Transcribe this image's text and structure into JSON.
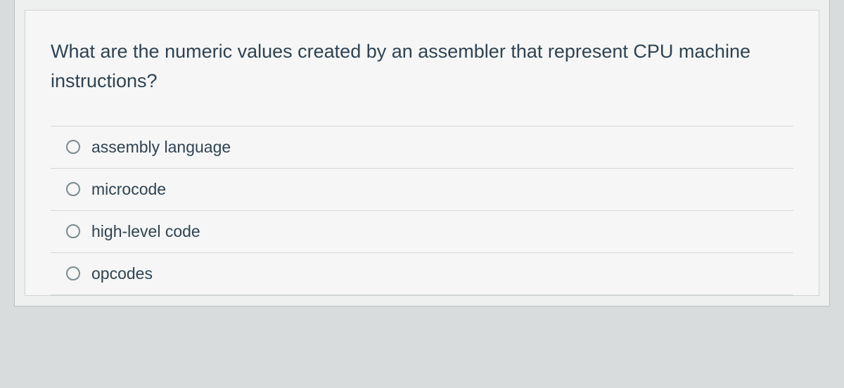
{
  "question": {
    "prompt": "What are the numeric values created by an assembler that represent CPU machine instructions?",
    "options": [
      {
        "label": "assembly language"
      },
      {
        "label": "microcode"
      },
      {
        "label": "high-level code"
      },
      {
        "label": "opcodes"
      }
    ]
  }
}
